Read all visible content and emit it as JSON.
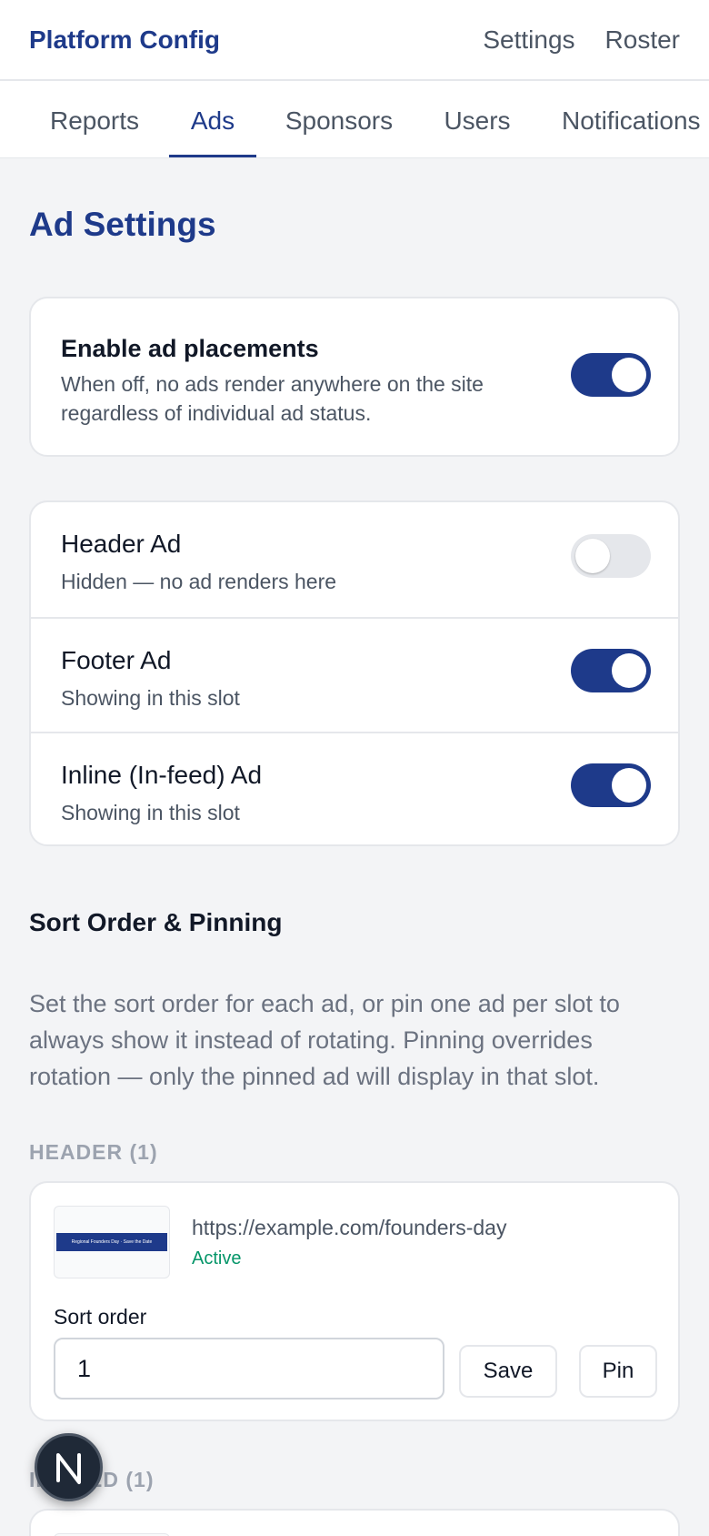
{
  "header": {
    "brand": "Platform Config",
    "links": [
      "Settings",
      "Roster"
    ]
  },
  "tabs": [
    {
      "label": "Reports",
      "active": false
    },
    {
      "label": "Ads",
      "active": true
    },
    {
      "label": "Sponsors",
      "active": false
    },
    {
      "label": "Users",
      "active": false
    },
    {
      "label": "Notifications",
      "active": false
    }
  ],
  "page": {
    "title": "Ad Settings"
  },
  "master_toggle": {
    "title": "Enable ad placements",
    "description": "When off, no ads render anywhere on the site regardless of individual ad status.",
    "enabled": true
  },
  "slots": [
    {
      "name": "Header Ad",
      "status": "Hidden — no ad renders here",
      "enabled": false
    },
    {
      "name": "Footer Ad",
      "status": "Showing in this slot",
      "enabled": true
    },
    {
      "name": "Inline (In-feed) Ad",
      "status": "Showing in this slot",
      "enabled": true
    }
  ],
  "sort_section": {
    "title": "Sort Order & Pinning",
    "description": "Set the sort order for each ad, or pin one ad per slot to always show it instead of rotating. Pinning overrides rotation — only the pinned ad will display in that slot."
  },
  "groups": [
    {
      "label": "HEADER (1)",
      "ads": [
        {
          "thumbnail_text": "Regional Founders Day · Save the Date",
          "url": "https://example.com/founders-day",
          "status": "Active",
          "sort_label": "Sort order",
          "sort_value": "1",
          "save_label": "Save",
          "pin_label": "Pin"
        }
      ]
    },
    {
      "label": "IN-FEED (1)",
      "ads": []
    }
  ],
  "dev_badge": {
    "letter": "N"
  },
  "colors": {
    "primary": "#1e3a8a",
    "active_status": "#059669",
    "muted_text": "#4b5563",
    "background": "#f3f4f6"
  }
}
